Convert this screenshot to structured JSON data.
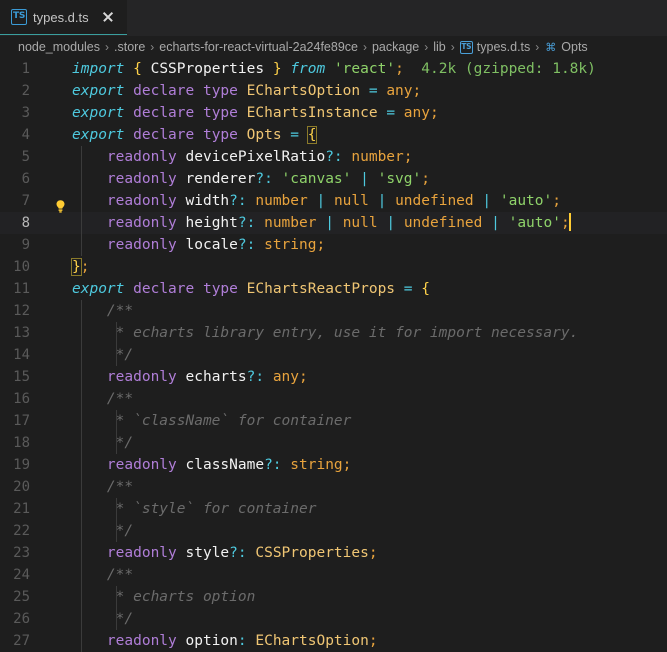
{
  "window": {
    "accent_teal": "#3a9e9e",
    "bg": "#1e1e1e",
    "active_line_bg": "#222224"
  },
  "tab": {
    "icon": "ts-file-icon",
    "icon_text": "TS",
    "label": "types.d.ts",
    "close_icon": "close-icon"
  },
  "breadcrumbs": [
    {
      "label": "node_modules",
      "icon": null
    },
    {
      "label": ".store",
      "icon": null
    },
    {
      "label": "echarts-for-react-virtual-2a24fe89ce",
      "icon": null
    },
    {
      "label": "package",
      "icon": null
    },
    {
      "label": "lib",
      "icon": null
    },
    {
      "label": "types.d.ts",
      "icon": "ts-file-icon",
      "icon_text": "TS"
    },
    {
      "label": "Opts",
      "icon": "symbol-interface-icon",
      "icon_text": "⌘"
    }
  ],
  "separator": "›",
  "editor": {
    "cursor_line": 8,
    "bulb_line": 8,
    "bulb_icon": "lightbulb-icon",
    "import_cost": "4.2k (gzipped: 1.8k)",
    "lines": [
      {
        "no": "1",
        "text": "import { CSSProperties } from 'react';"
      },
      {
        "no": "2",
        "text": "export declare type EChartsOption = any;"
      },
      {
        "no": "3",
        "text": "export declare type EChartsInstance = any;"
      },
      {
        "no": "4",
        "text": "export declare type Opts = {"
      },
      {
        "no": "5",
        "text": "    readonly devicePixelRatio?: number;"
      },
      {
        "no": "6",
        "text": "    readonly renderer?: 'canvas' | 'svg';"
      },
      {
        "no": "7",
        "text": "    readonly width?: number | null | undefined | 'auto';"
      },
      {
        "no": "8",
        "text": "    readonly height?: number | null | undefined | 'auto';"
      },
      {
        "no": "9",
        "text": "    readonly locale?: string;"
      },
      {
        "no": "10",
        "text": "};"
      },
      {
        "no": "11",
        "text": "export declare type EChartsReactProps = {"
      },
      {
        "no": "12",
        "text": "    /**"
      },
      {
        "no": "13",
        "text": "     * echarts library entry, use it for import necessary."
      },
      {
        "no": "14",
        "text": "     */"
      },
      {
        "no": "15",
        "text": "    readonly echarts?: any;"
      },
      {
        "no": "16",
        "text": "    /**"
      },
      {
        "no": "17",
        "text": "     * `className` for container"
      },
      {
        "no": "18",
        "text": "     */"
      },
      {
        "no": "19",
        "text": "    readonly className?: string;"
      },
      {
        "no": "20",
        "text": "    /**"
      },
      {
        "no": "21",
        "text": "     * `style` for container"
      },
      {
        "no": "22",
        "text": "     */"
      },
      {
        "no": "23",
        "text": "    readonly style?: CSSProperties;"
      },
      {
        "no": "24",
        "text": "    /**"
      },
      {
        "no": "25",
        "text": "     * echarts option"
      },
      {
        "no": "26",
        "text": "     */"
      },
      {
        "no": "27",
        "text": "    readonly option: EChartsOption;"
      }
    ]
  }
}
